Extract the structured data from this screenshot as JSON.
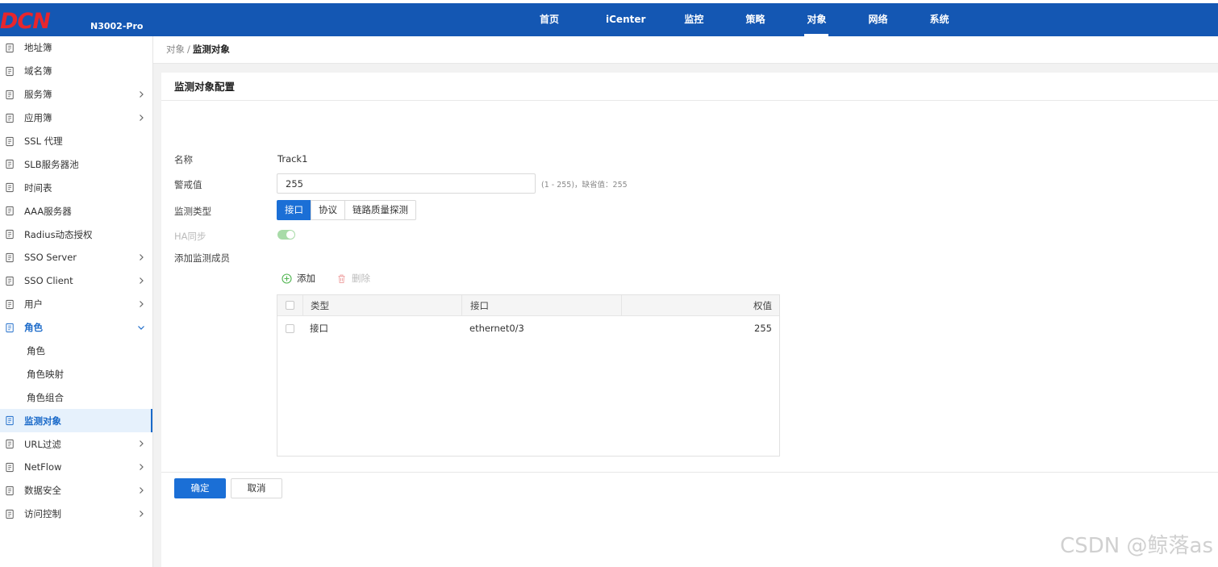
{
  "header": {
    "logo": "DCN",
    "model": "N3002-Pro",
    "nav": [
      "首页",
      "iCenter",
      "监控",
      "策略",
      "对象",
      "网络",
      "系统"
    ],
    "active_nav": "对象"
  },
  "sidebar": {
    "items": [
      {
        "label": "地址簿",
        "icon": "address-book-icon",
        "chevron": false
      },
      {
        "label": "域名簿",
        "icon": "domain-book-icon",
        "chevron": false
      },
      {
        "label": "服务簿",
        "icon": "service-book-icon",
        "chevron": true
      },
      {
        "label": "应用簿",
        "icon": "app-book-icon",
        "chevron": true
      },
      {
        "label": "SSL 代理",
        "icon": "ssl-proxy-icon",
        "chevron": false
      },
      {
        "label": "SLB服务器池",
        "icon": "server-pool-icon",
        "chevron": false
      },
      {
        "label": "时间表",
        "icon": "calendar-icon",
        "chevron": false
      },
      {
        "label": "AAA服务器",
        "icon": "aaa-server-icon",
        "chevron": false
      },
      {
        "label": "Radius动态授权",
        "icon": "shield-icon",
        "chevron": false
      },
      {
        "label": "SSO Server",
        "icon": "sso-server-icon",
        "chevron": true
      },
      {
        "label": "SSO Client",
        "icon": "sso-client-icon",
        "chevron": true
      },
      {
        "label": "用户",
        "icon": "user-icon",
        "chevron": true
      },
      {
        "label": "角色",
        "icon": "role-icon",
        "chevron": true,
        "open": true
      },
      {
        "label": "角色",
        "sub": true
      },
      {
        "label": "角色映射",
        "sub": true
      },
      {
        "label": "角色组合",
        "sub": true
      },
      {
        "label": "监测对象",
        "icon": "monitor-shield-icon",
        "chevron": false,
        "active": true
      },
      {
        "label": "URL过滤",
        "icon": "url-filter-icon",
        "chevron": true
      },
      {
        "label": "NetFlow",
        "icon": "netflow-icon",
        "chevron": true
      },
      {
        "label": "数据安全",
        "icon": "data-security-icon",
        "chevron": true
      },
      {
        "label": "访问控制",
        "icon": "access-control-icon",
        "chevron": true
      }
    ]
  },
  "breadcrumb": {
    "parent": "对象",
    "separator": "/",
    "current": "监测对象"
  },
  "panel": {
    "title": "监测对象配置",
    "labels": {
      "name": "名称",
      "threshold": "警戒值",
      "type": "监测类型",
      "ha": "HA同步",
      "members": "添加监测成员"
    },
    "name_value": "Track1",
    "threshold_value": "255",
    "threshold_hint": "(1 - 255)，缺省值：255",
    "type_options": [
      "接口",
      "协议",
      "链路质量探测"
    ],
    "type_selected": "接口",
    "ha_sync": true,
    "toolbar": {
      "add": "添加",
      "delete": "删除"
    },
    "table": {
      "columns": [
        "类型",
        "接口",
        "权值"
      ],
      "rows": [
        {
          "type": "接口",
          "interface": "ethernet0/3",
          "weight": "255"
        }
      ]
    },
    "buttons": {
      "ok": "确定",
      "cancel": "取消"
    }
  },
  "watermark": "CSDN @鲸落as",
  "colors": {
    "header": "#1457b3",
    "logo": "#e8262d",
    "primary": "#1b6fd6",
    "toggle_on": "#a8dba8"
  }
}
